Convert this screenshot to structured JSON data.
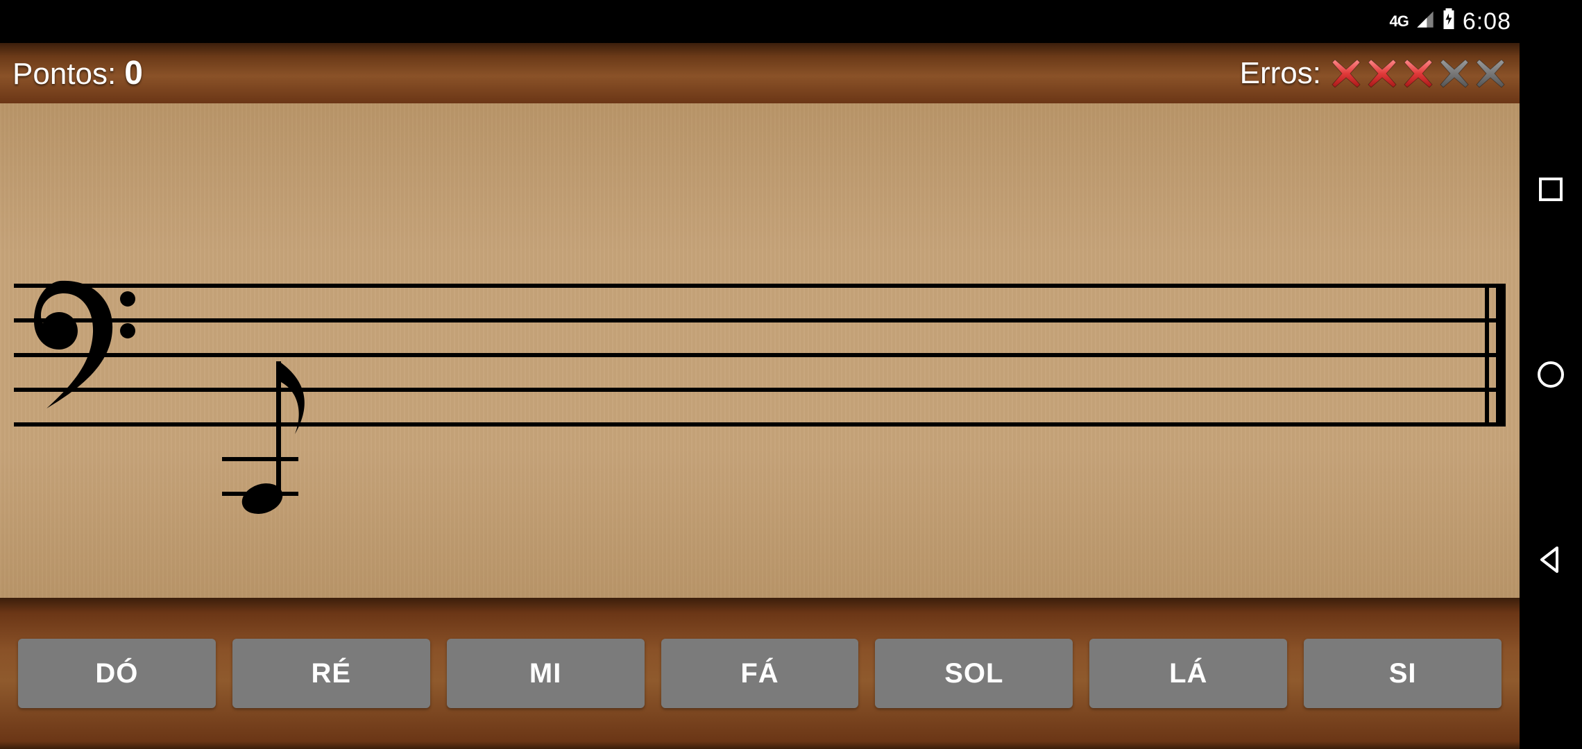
{
  "statusBar": {
    "network": "4G",
    "clock": "6:08"
  },
  "header": {
    "scoreLabel": "Pontos:",
    "scoreValue": "0",
    "errorsLabel": "Erros:",
    "errorsUsed": 3,
    "errorsTotal": 5
  },
  "staff": {
    "clef": "bass",
    "displayedNote": "eighth-note-below-staff"
  },
  "buttons": [
    {
      "id": "do",
      "label": "DÓ"
    },
    {
      "id": "re",
      "label": "RÉ"
    },
    {
      "id": "mi",
      "label": "MI"
    },
    {
      "id": "fa",
      "label": "FÁ"
    },
    {
      "id": "sol",
      "label": "SOL"
    },
    {
      "id": "la",
      "label": "LÁ"
    },
    {
      "id": "si",
      "label": "SI"
    }
  ],
  "colors": {
    "errorActive": "#e13a3a",
    "errorInactive": "#6e6e6e",
    "buttonBg": "#7b7b7b"
  }
}
